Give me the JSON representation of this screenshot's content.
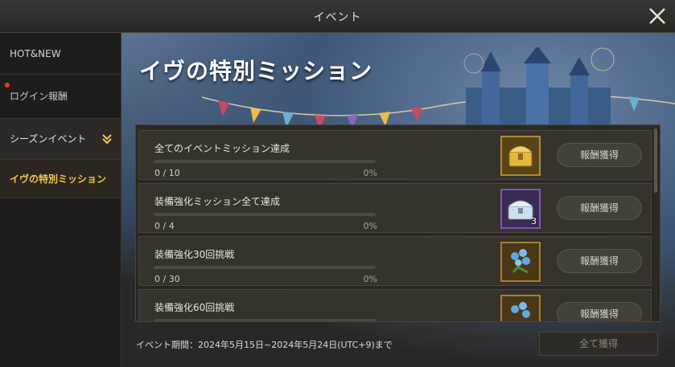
{
  "window": {
    "title": "イベント"
  },
  "sidebar": {
    "items": [
      {
        "label": "HOT&NEW"
      },
      {
        "label": "ログイン報酬"
      },
      {
        "label": "シーズンイベント"
      },
      {
        "label": "イヴの特別ミッション"
      }
    ]
  },
  "banner": {
    "title": "イヴの特別ミッション"
  },
  "missions": [
    {
      "title": "全てのイベントミッション達成",
      "progress": "0 / 10",
      "percent": "0%",
      "progress_fraction": 0,
      "reward_icon": "gold-chest-icon",
      "reward_qty": "",
      "button": "報酬獲得"
    },
    {
      "title": "装備強化ミッション全て達成",
      "progress": "0 / 4",
      "percent": "0%",
      "progress_fraction": 0,
      "reward_icon": "silver-chest-icon",
      "reward_qty": "3",
      "button": "報酬獲得"
    },
    {
      "title": "装備強化30回挑戦",
      "progress": "0 / 30",
      "percent": "0%",
      "progress_fraction": 0,
      "reward_icon": "blue-flower-icon",
      "reward_qty": "",
      "button": "報酬獲得"
    },
    {
      "title": "装備強化60回挑戦",
      "progress": "",
      "percent": "",
      "progress_fraction": 0,
      "reward_icon": "blue-flower-icon",
      "reward_qty": "",
      "button": "報酬獲得"
    }
  ],
  "footer": {
    "period": "イベント期間：2024年5月15日~2024年5月24日(UTC+9)まで",
    "claim_all": "全て獲得"
  },
  "colors": {
    "accent": "#f2c94c",
    "notification": "#e8372b",
    "panel": "#36322c"
  }
}
